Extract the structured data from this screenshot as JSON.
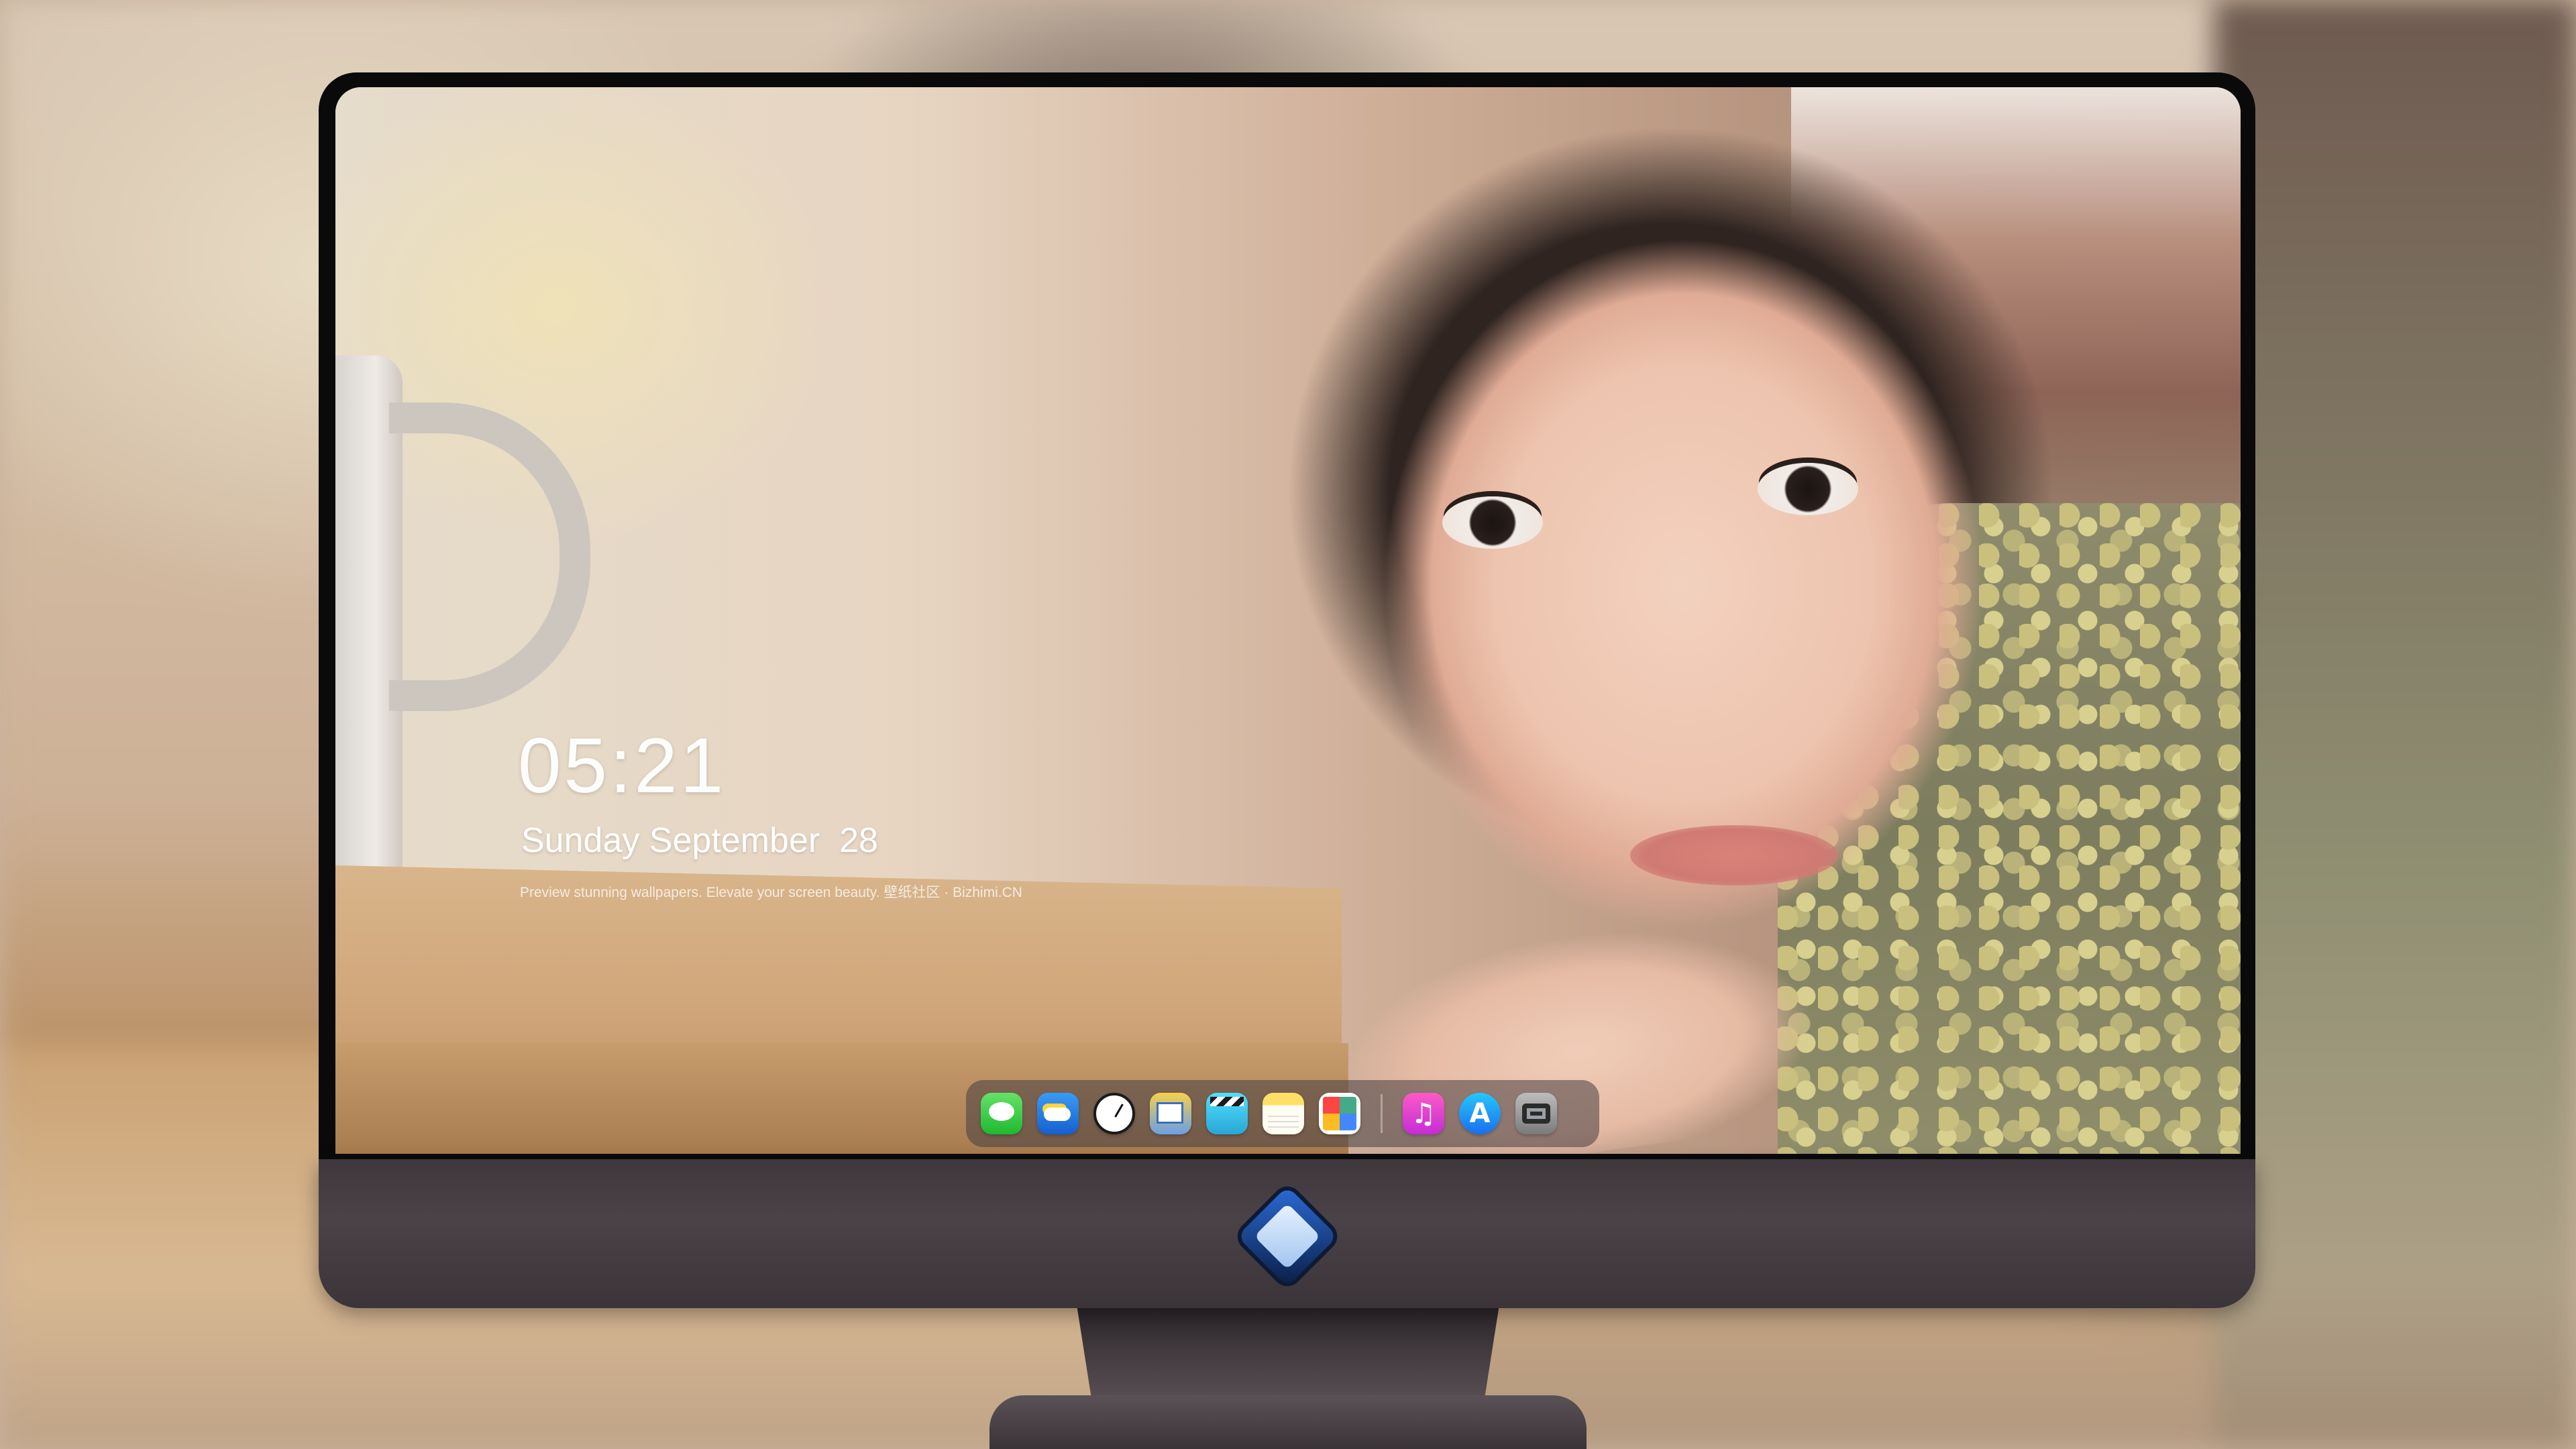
{
  "lock_screen": {
    "time": "05:21",
    "date": "Sunday September  28",
    "tagline": "Preview stunning wallpapers. Elevate your screen beauty. 壁纸社区 · Bizhimi.CN"
  },
  "dock": {
    "apps": [
      {
        "icon": "messages-icon"
      },
      {
        "icon": "weather-icon"
      },
      {
        "icon": "clock-icon"
      },
      {
        "icon": "preview-icon"
      },
      {
        "icon": "video-editor-icon"
      },
      {
        "icon": "notes-icon"
      },
      {
        "icon": "photo-collage-icon"
      },
      {
        "icon": "music-icon"
      },
      {
        "icon": "app-store-icon"
      },
      {
        "icon": "camera-icon"
      }
    ]
  },
  "monitor": {
    "logo_icon": "brand-logo-icon"
  }
}
